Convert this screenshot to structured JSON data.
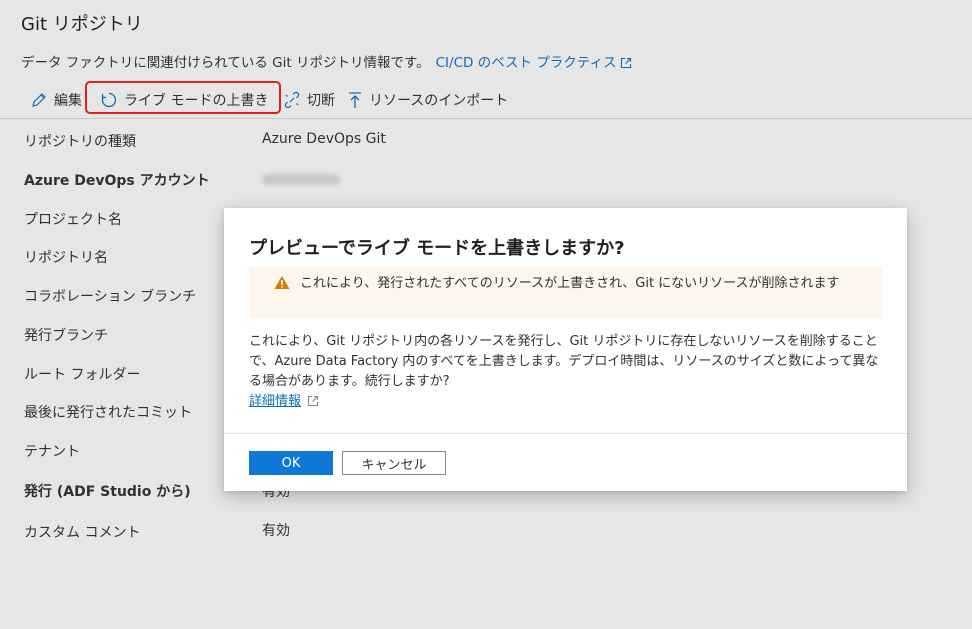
{
  "page": {
    "title": "Git リポジトリ",
    "description": "データ ファクトリに関連付けられている Git リポジトリ情報です。",
    "best_practices_link": "CI/CD のベスト プラクティス"
  },
  "toolbar": {
    "edit_label": "編集",
    "overwrite_live_label": "ライブ モードの上書き",
    "disconnect_label": "切断",
    "import_resources_label": "リソースのインポート"
  },
  "properties": [
    {
      "label": "リポジトリの種類",
      "value": "Azure DevOps Git"
    },
    {
      "label": "Azure DevOps アカウント",
      "value": ""
    },
    {
      "label": "プロジェクト名",
      "value": ""
    },
    {
      "label": "リポジトリ名",
      "value": ""
    },
    {
      "label": "コラボレーション ブランチ",
      "value": ""
    },
    {
      "label": "発行ブランチ",
      "value": ""
    },
    {
      "label": "ルート フォルダー",
      "value": ""
    },
    {
      "label": "最後に発行されたコミット",
      "value": ""
    },
    {
      "label": "テナント",
      "value": ""
    },
    {
      "label": "発行 (ADF Studio から)",
      "value": "有効"
    },
    {
      "label": "カスタム コメント",
      "value": "有効"
    }
  ],
  "dialog": {
    "title": "プレビューでライブ モードを上書きしますか?",
    "warning": "これにより、発行されたすべてのリソースが上書きされ、Git にないリソースが削除されます",
    "body": "これにより、Git リポジトリ内の各リソースを発行し、Git リポジトリに存在しないリソースを削除することで、Azure Data Factory 内のすべてを上書きします。デプロイ時間は、リソースのサイズと数によって異なる場合があります。続行しますか?",
    "learn_more_link": "詳細情報",
    "ok_label": "OK",
    "cancel_label": "キャンセル"
  },
  "colors": {
    "accent": "#0f78d4",
    "link": "#0f6cbd",
    "highlight_border": "#e0201c",
    "warning_icon": "#d67b00",
    "warning_bg": "#fdf6ec"
  }
}
